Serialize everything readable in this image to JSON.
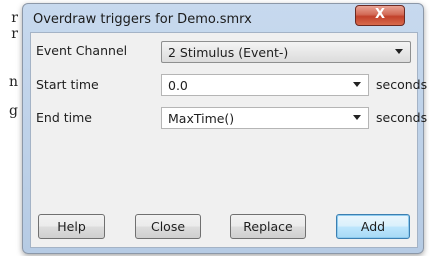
{
  "background_fragments": [
    "r",
    "r",
    "n",
    "g"
  ],
  "dialog": {
    "title": "Overdraw triggers for Demo.smrx",
    "close_glyph": "X"
  },
  "fields": {
    "event_channel": {
      "label": "Event Channel",
      "value": "2 Stimulus (Event-)"
    },
    "start_time": {
      "label": "Start time",
      "value": "0.0",
      "unit": "seconds"
    },
    "end_time": {
      "label": "End time",
      "value": "MaxTime()",
      "unit": "seconds"
    }
  },
  "buttons": {
    "help": "Help",
    "close": "Close",
    "replace": "Replace",
    "add": "Add"
  },
  "colors": {
    "close_button": "#c2412b",
    "default_button_border": "#3c7fb1"
  }
}
